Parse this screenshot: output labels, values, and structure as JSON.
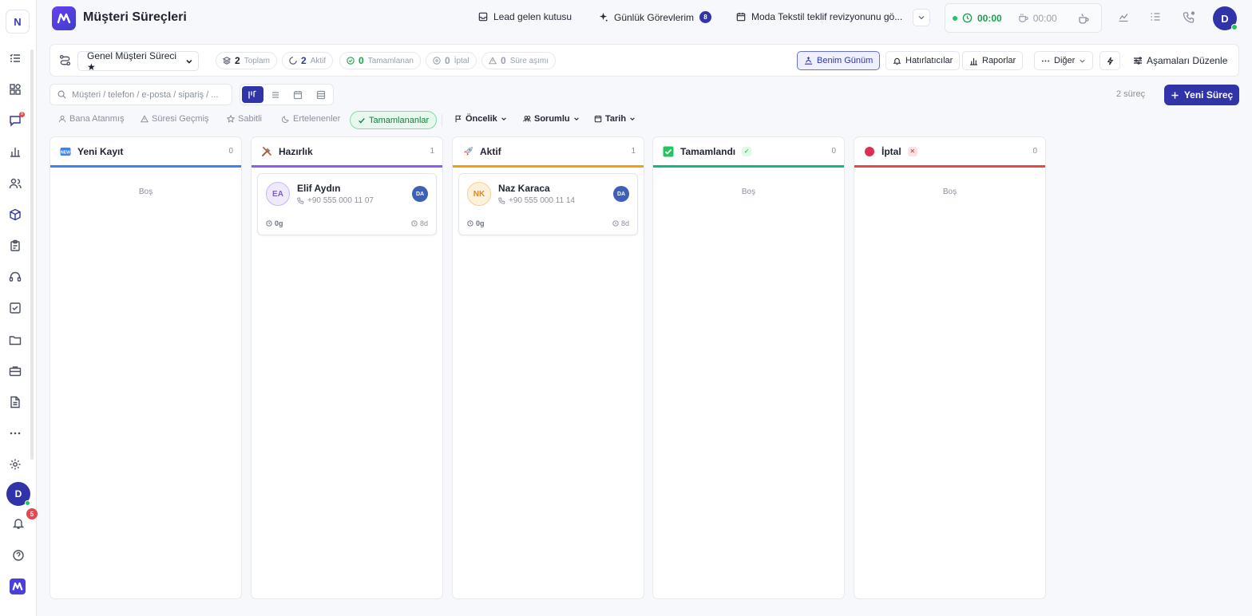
{
  "rail": {
    "workspace_letter": "N",
    "user_initial": "D",
    "notification_count": "5",
    "messages_badge": "8"
  },
  "header": {
    "title": "Müşteri Süreçleri",
    "lead_inbox": "Lead gelen kutusu",
    "daily_tasks": "Günlük Görevlerim",
    "daily_tasks_count": "8",
    "event": "Moda Tekstil teklif revizyonunu gö...",
    "timer_work": "00:00",
    "timer_break": "00:00",
    "user_initial": "D"
  },
  "toolbar": {
    "pipeline": "Genel Müşteri Süreci ★",
    "stats": {
      "total": {
        "value": "2",
        "label": "Toplam"
      },
      "active": {
        "value": "2",
        "label": "Aktif"
      },
      "completed": {
        "value": "0",
        "label": "Tamamlanan"
      },
      "cancelled": {
        "value": "0",
        "label": "İptal"
      },
      "overdue": {
        "value": "0",
        "label": "Süre aşımı"
      }
    },
    "my_day": "Benim Günüm",
    "reminders": "Hatırlatıcılar",
    "reports": "Raporlar",
    "more": "Diğer",
    "edit_stages": "Aşamaları Düzenle"
  },
  "search": {
    "placeholder": "Müşteri / telefon / e-posta / sipariş / ..."
  },
  "summary": {
    "process_count": "2 süreç",
    "new_process": "Yeni Süreç"
  },
  "filters": {
    "assigned_to_me": "Bana Atanmış",
    "overdue": "Süresi Geçmiş",
    "pinned": "Sabitli",
    "postponed": "Ertelenenler",
    "completed": "Tamamlananlar",
    "priority": "Öncelik",
    "owner": "Sorumlu",
    "date": "Tarih"
  },
  "columns": [
    {
      "title": "Yeni Kayıt",
      "count": "0",
      "color": "#3b82f6",
      "empty": "Boş"
    },
    {
      "title": "Hazırlık",
      "count": "1",
      "color": "#8b5cf6",
      "card": {
        "initials": "EA",
        "name": "Elif Aydın",
        "phone": "+90 555 000 11 07",
        "owner": "DA",
        "age": "0g",
        "due": "8d"
      }
    },
    {
      "title": "Aktif",
      "count": "1",
      "color": "#f59e0b",
      "card": {
        "initials": "NK",
        "name": "Naz Karaca",
        "phone": "+90 555 000 11 14",
        "owner": "DA",
        "age": "0g",
        "due": "8d"
      }
    },
    {
      "title": "Tamamlandı",
      "count": "0",
      "color": "#10b981",
      "empty": "Boş"
    },
    {
      "title": "İptal",
      "count": "0",
      "color": "#ef4444",
      "empty": "Boş"
    }
  ],
  "colors": {
    "brand": "#3134a8",
    "success": "#16a34a",
    "danger": "#e5484d"
  },
  "icons": [
    "list-icon",
    "dashboard-icon",
    "chat-icon",
    "chart-icon",
    "users-icon",
    "box-icon",
    "clipboard-icon",
    "headset-icon",
    "check-square-icon",
    "folder-icon",
    "briefcase-icon",
    "document-icon",
    "more-icon",
    "settings-icon",
    "bell-icon",
    "help-icon"
  ]
}
